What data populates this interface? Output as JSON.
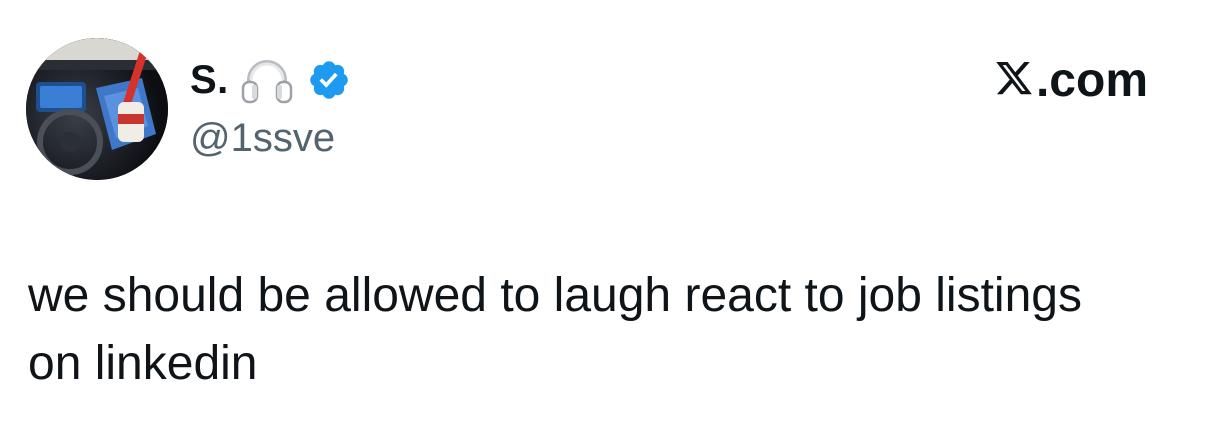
{
  "author": {
    "display_name": "S.",
    "handle": "@1ssve",
    "avatar_icon": "profile-photo-car-dashboard",
    "name_emoji_icon": "headphones-icon",
    "verified_icon": "verified-badge-icon",
    "verified_color": "#1d9bf0"
  },
  "brand": {
    "logo_icon": "x-logo-icon",
    "suffix": ".com"
  },
  "tweet": {
    "text": "we should be allowed to laugh react to job listings on linkedin"
  },
  "colors": {
    "text_primary": "#0f1419",
    "text_secondary": "#536471",
    "background": "#ffffff"
  }
}
